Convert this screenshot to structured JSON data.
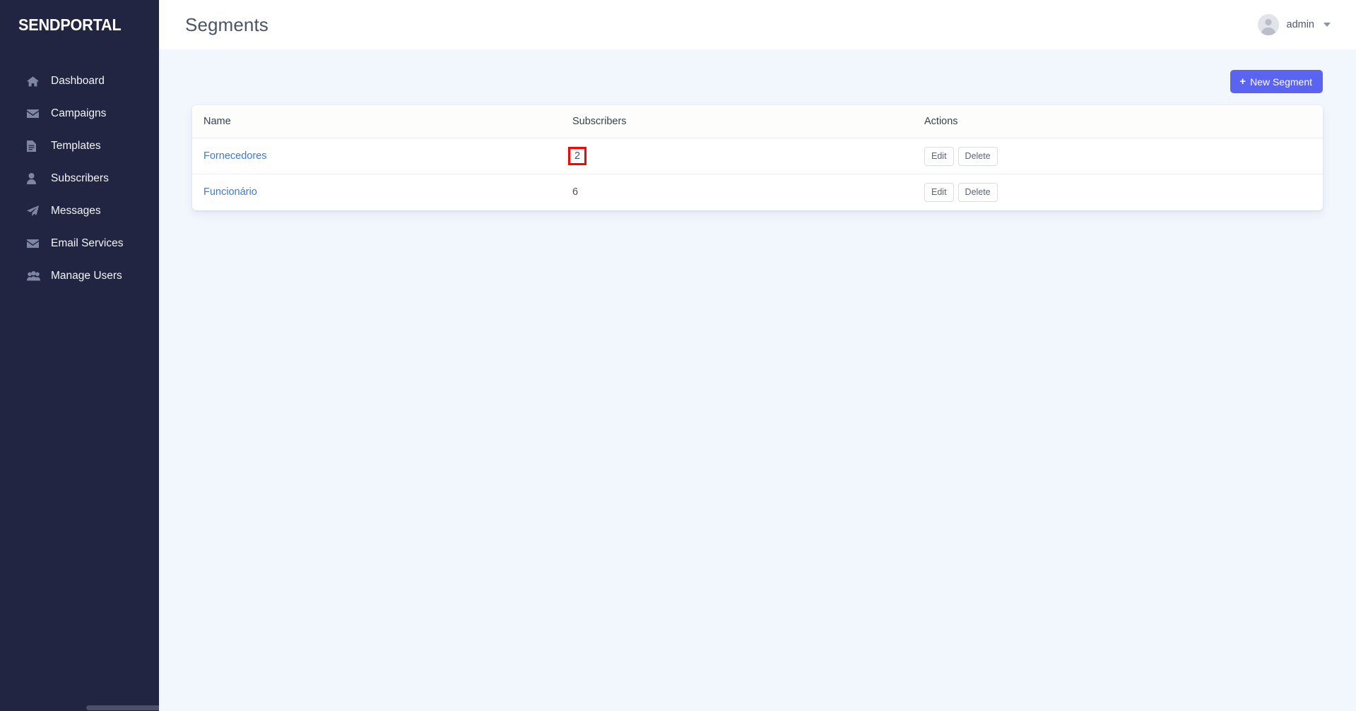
{
  "sidebar": {
    "logo": "SENDPORTAL",
    "items": [
      {
        "label": "Dashboard",
        "icon": "home-icon"
      },
      {
        "label": "Campaigns",
        "icon": "envelope-icon"
      },
      {
        "label": "Templates",
        "icon": "document-icon"
      },
      {
        "label": "Subscribers",
        "icon": "user-icon"
      },
      {
        "label": "Messages",
        "icon": "paper-plane-icon"
      },
      {
        "label": "Email Services",
        "icon": "envelope-icon"
      },
      {
        "label": "Manage Users",
        "icon": "users-group-icon"
      }
    ]
  },
  "header": {
    "title": "Segments",
    "user": "admin",
    "avatar_icon": "user-avatar-icon",
    "caret_icon": "chevron-down-icon"
  },
  "toolbar": {
    "new_segment_label": "New Segment",
    "new_segment_plus": "+"
  },
  "table": {
    "columns": [
      "Name",
      "Subscribers",
      "Actions"
    ],
    "rows": [
      {
        "name": "Fornecedores",
        "subscribers": "2",
        "highlighted": true,
        "edit_label": "Edit",
        "delete_label": "Delete"
      },
      {
        "name": "Funcionário",
        "subscribers": "6",
        "highlighted": false,
        "edit_label": "Edit",
        "delete_label": "Delete"
      }
    ]
  },
  "colors": {
    "sidebar_bg": "#222542",
    "page_bg": "#f2f6fd",
    "accent": "#5a63f2",
    "link": "#3f79d4",
    "highlight_border": "#fe0000"
  }
}
